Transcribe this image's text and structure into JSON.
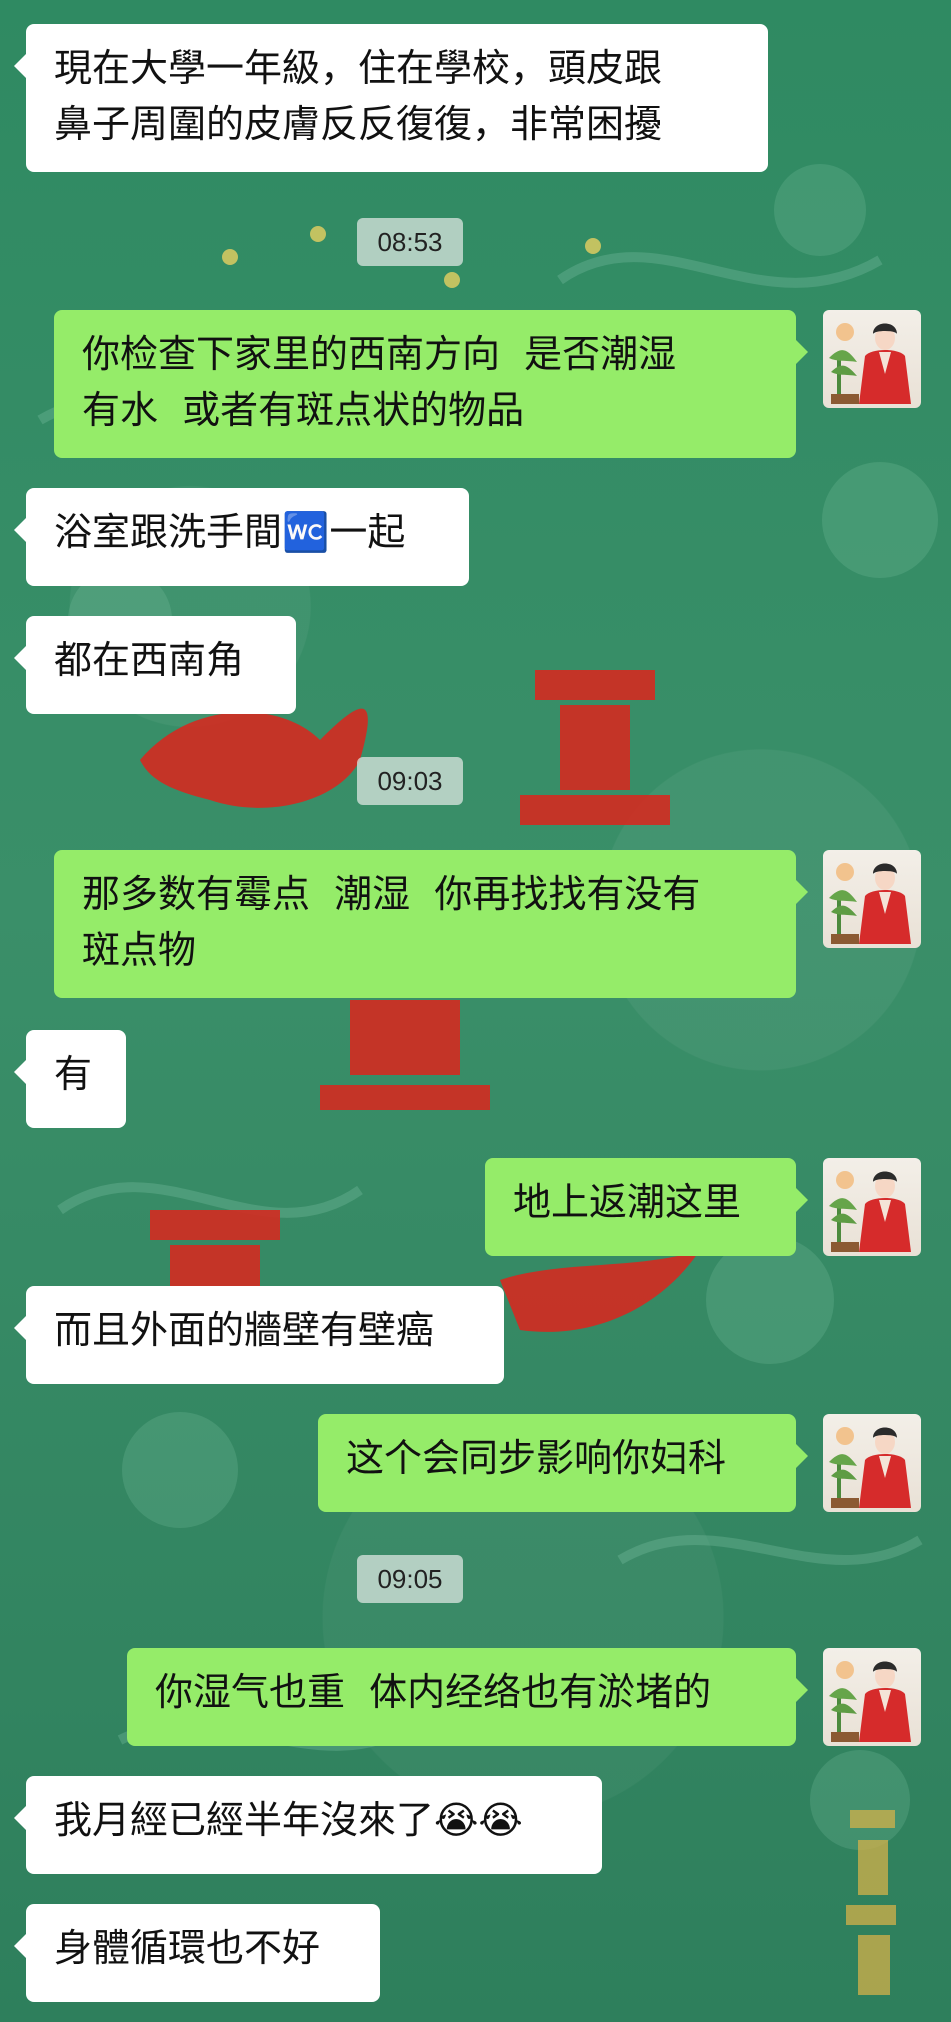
{
  "messages": [
    {
      "kind": "text",
      "side": "left",
      "text": "現在大學一年級，住在學校，頭皮跟\n鼻子周圍的皮膚反反復復，非常困擾"
    },
    {
      "kind": "time",
      "text": "08:53"
    },
    {
      "kind": "text",
      "side": "right",
      "text": "你检查下家里的西南方向  是否潮湿\n有水  或者有斑点状的物品"
    },
    {
      "kind": "text",
      "side": "left",
      "text": "浴室跟洗手間🚾一起"
    },
    {
      "kind": "text",
      "side": "left",
      "text": "都在西南角"
    },
    {
      "kind": "time",
      "text": "09:03"
    },
    {
      "kind": "text",
      "side": "right",
      "text": "那多数有霉点  潮湿  你再找找有没有\n斑点物"
    },
    {
      "kind": "text",
      "side": "left",
      "text": "有"
    },
    {
      "kind": "text",
      "side": "right",
      "text": "地上返潮这里"
    },
    {
      "kind": "text",
      "side": "left",
      "text": "而且外面的牆壁有壁癌"
    },
    {
      "kind": "text",
      "side": "right",
      "text": "这个会同步影响你妇科"
    },
    {
      "kind": "time",
      "text": "09:05"
    },
    {
      "kind": "text",
      "side": "right",
      "text": "你湿气也重  体内经络也有淤堵的"
    },
    {
      "kind": "text",
      "side": "left",
      "text": "我月經已經半年沒來了😭😭"
    },
    {
      "kind": "text",
      "side": "left",
      "text": "身體循環也不好"
    }
  ],
  "colors": {
    "background": "#2f8a62",
    "left_bubble": "#ffffff",
    "right_bubble": "#95ec69",
    "text": "#111111"
  },
  "avatar_icon": "woman-in-red-dress-avatar-icon"
}
